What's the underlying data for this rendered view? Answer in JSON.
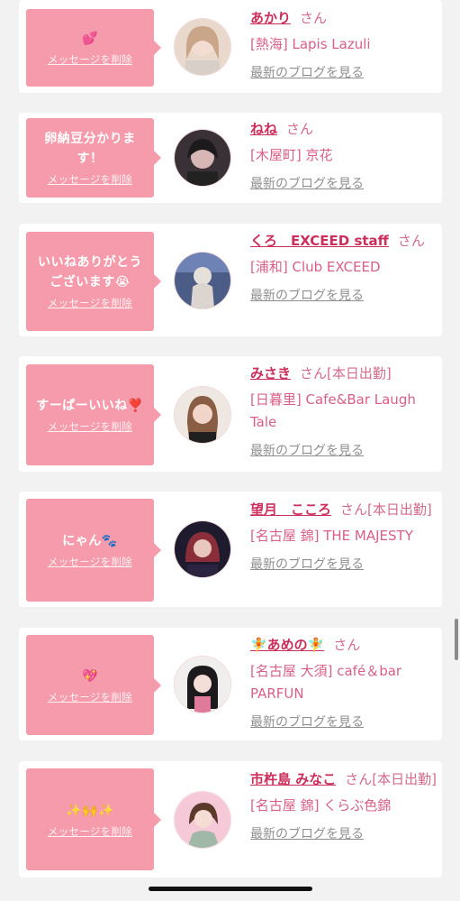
{
  "delete_label": "メッセージを削除",
  "blog_label": "最新のブログを見る",
  "honorific": "さん",
  "cards": [
    {
      "message": "💕",
      "name": "あかり",
      "suffix": "",
      "shop": "[熱海] Lapis Lazuli"
    },
    {
      "message": "卵納豆分かります！",
      "name": "ねね",
      "suffix": "",
      "shop": "[木屋町] 京花"
    },
    {
      "message": "いいねありがとうございます😭",
      "name": "くろ　EXCEED staff",
      "suffix": "",
      "shop": "[浦和] Club EXCEED"
    },
    {
      "message": "すーぱーいいね❣️",
      "name": "みさき",
      "suffix": "[本日出勤]",
      "shop": "[日暮里] Cafe&Bar Laugh Tale"
    },
    {
      "message": "にゃん🐾",
      "name": "望月　こころ",
      "suffix": "[本日出勤]",
      "shop": "[名古屋 錦] THE MAJESTY"
    },
    {
      "message": "💖",
      "name": "🧚あめの🧚",
      "suffix": "",
      "shop": "[名古屋 大須] café＆bar PARFUN"
    },
    {
      "message": "✨🙌✨",
      "name": "市杵島 みなこ",
      "suffix": "[本日出勤]",
      "shop": "[名古屋 錦] くらぶ色錦"
    }
  ],
  "colors": {
    "background": "#f2f2f2",
    "bubble": "#f59bab",
    "name": "#cc2f5c",
    "shop": "#d95f86",
    "link": "#8f8f8f"
  }
}
